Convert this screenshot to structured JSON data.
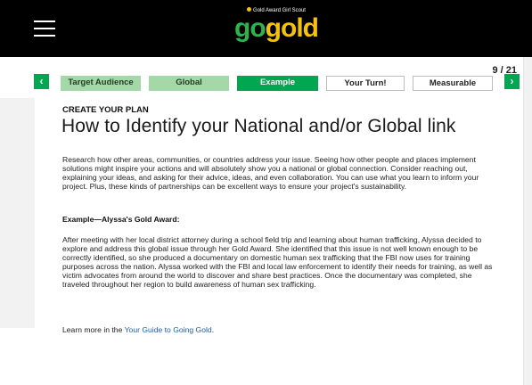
{
  "header": {
    "menu_icon": "hamburger-menu-icon",
    "logo_tagline": "Gold Award Girl Scout",
    "logo_go": "go",
    "logo_gold": "gold"
  },
  "pager": {
    "count": "9 / 21",
    "prev_icon": "chevron-left-icon",
    "next_icon": "chevron-right-icon",
    "prev_glyph": "‹",
    "next_glyph": "›"
  },
  "tabs": [
    {
      "label": "Target Audience"
    },
    {
      "label": "Global"
    },
    {
      "label": "Example"
    },
    {
      "label": "Your Turn!"
    },
    {
      "label": "Measurable"
    }
  ],
  "main": {
    "eyebrow": "CREATE YOUR PLAN",
    "title": "How to Identify your National and/or Global link",
    "intro": "Research how other areas, communities, or countries address your issue. Seeing how other people and places implement solutions might inspire your actions and will absolutely show you a national or global connection. Consider reaching out, explaining your ideas, and asking for their advice, ideas, and even collaboration. You can use what you learn to inform your project. Plus, these kinds of partnerships can be excellent ways to ensure your project's sustainability.",
    "example_heading": "Example—Alyssa's Gold Award:",
    "example_body": "After meeting with her local district attorney during a school field trip and learning about human trafficking, Alyssa decided to explore and address this global issue through her Gold Award. She identified that this issue is not well known enough to be correctly identified, so she produced a documentary on domestic human sex trafficking that the FBI now uses for training purposes across the nation. Alyssa worked with the FBI and local law enforcement to identify their needs for training, as well as victim advocates from around the world to discover and share best practices. Once the documentary was completed, she traveled throughout her region to build awareness of human sex trafficking.",
    "learn_prefix": "Learn more in the ",
    "learn_link": "Your Guide to Going Gold",
    "learn_suffix": "."
  }
}
